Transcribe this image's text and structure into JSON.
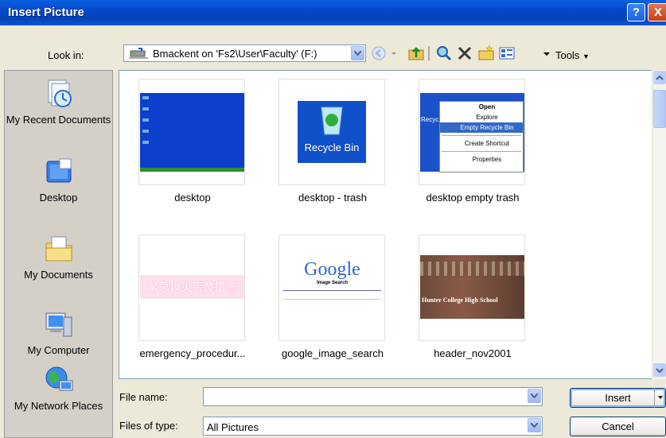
{
  "window": {
    "title": "Insert Picture",
    "help": "?",
    "close": "X"
  },
  "lookin": {
    "label": "Look in:",
    "value": "Bmackent on 'Fs2\\User\\Faculty' (F:)"
  },
  "toolbar": {
    "tools_label": "Tools",
    "icons": [
      "back-icon",
      "up-folder-icon",
      "search-web-icon",
      "delete-icon",
      "new-folder-icon",
      "views-icon"
    ]
  },
  "places": [
    {
      "label": "My Recent Documents"
    },
    {
      "label": "Desktop"
    },
    {
      "label": "My Documents"
    },
    {
      "label": "My Computer"
    },
    {
      "label": "My Network Places"
    }
  ],
  "files": [
    {
      "name": "desktop"
    },
    {
      "name": "desktop - trash",
      "thumb_text": "Recycle Bin"
    },
    {
      "name": "desktop empty trash",
      "menu": [
        "Open",
        "Explore",
        "Empty Recycle Bin",
        "Create Shortcut",
        "Properties"
      ],
      "thumb_text": "Recyc"
    },
    {
      "name": "emergency_procedur...",
      "thumb_text": "緊急以災害發措施"
    },
    {
      "name": "google_image_search",
      "thumb_text": "Google",
      "thumb_sub": "Image Search"
    },
    {
      "name": "header_nov2001",
      "thumb_text": "Hunter College High School"
    }
  ],
  "filename": {
    "label": "File name:",
    "value": ""
  },
  "filetype": {
    "label": "Files of type:",
    "value": "All Pictures"
  },
  "buttons": {
    "insert": "Insert",
    "cancel": "Cancel"
  },
  "colors": {
    "titlebar": "#0548c8",
    "dialog_bg": "#ece9d8",
    "desktop_blue": "#0b3fcc"
  }
}
